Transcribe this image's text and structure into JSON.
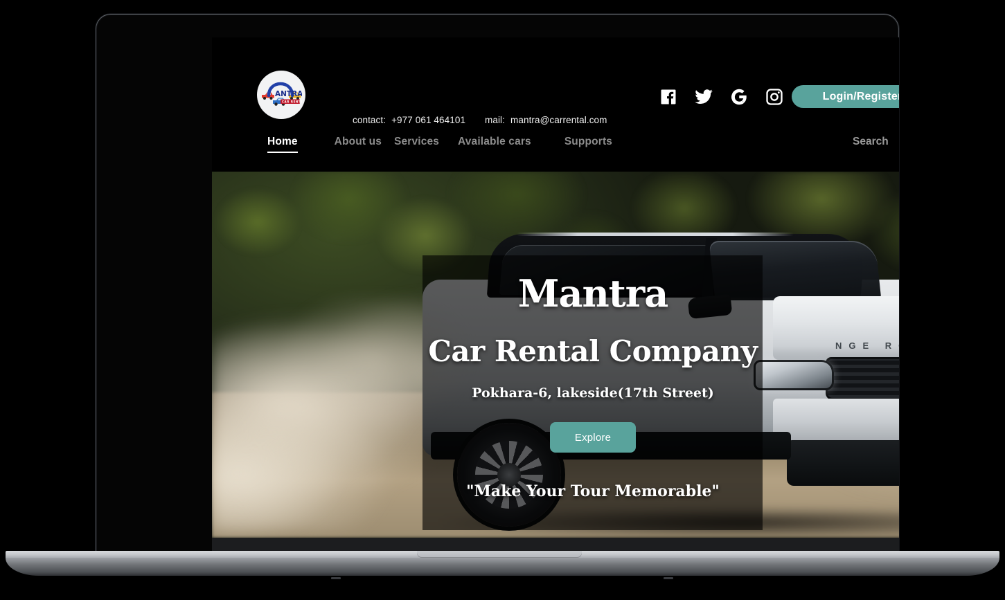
{
  "device": {
    "type": "laptop-mockup",
    "camera_icon": "camera-dot"
  },
  "site": {
    "brand": {
      "logo_name": "Mantra",
      "logo_sub": "CAR RENTAL",
      "logo_alt": "Mantra Car Rental logo"
    },
    "topbar": {
      "contact_label": "contact:",
      "contact_value": "+977 061 464101",
      "mail_label": "mail:",
      "mail_value": "mantra@carrental.com",
      "social": [
        {
          "name": "facebook-icon",
          "label": "Facebook"
        },
        {
          "name": "twitter-icon",
          "label": "Twitter"
        },
        {
          "name": "google-icon",
          "label": "Google"
        },
        {
          "name": "instagram-icon",
          "label": "Instagram"
        }
      ],
      "login_label": "Login/Register",
      "accent_color": "#59a39c"
    },
    "nav": {
      "items": [
        {
          "label": "Home",
          "active": true
        },
        {
          "label": "About us",
          "active": false
        },
        {
          "label": "Services",
          "active": false
        },
        {
          "label": "Available cars",
          "active": false
        },
        {
          "label": "Supports",
          "active": false
        }
      ],
      "search_label": "Search",
      "search_icon": "search-icon"
    },
    "hero": {
      "title": "Mantra",
      "subtitle": "Car Rental Company",
      "address": "Pokhara-6, lakeside(17th Street)",
      "cta_label": "Explore",
      "tagline": "\"Make Your Tour Memorable\"",
      "background_alt": "White Range Rover SUV driving on a dusty forest trail",
      "car_badge": "NGE ROVER"
    },
    "colors": {
      "page_background": "#000000",
      "accent_teal": "#59a39c",
      "nav_inactive": "#8d8d8d",
      "text_primary": "#ffffff"
    }
  }
}
